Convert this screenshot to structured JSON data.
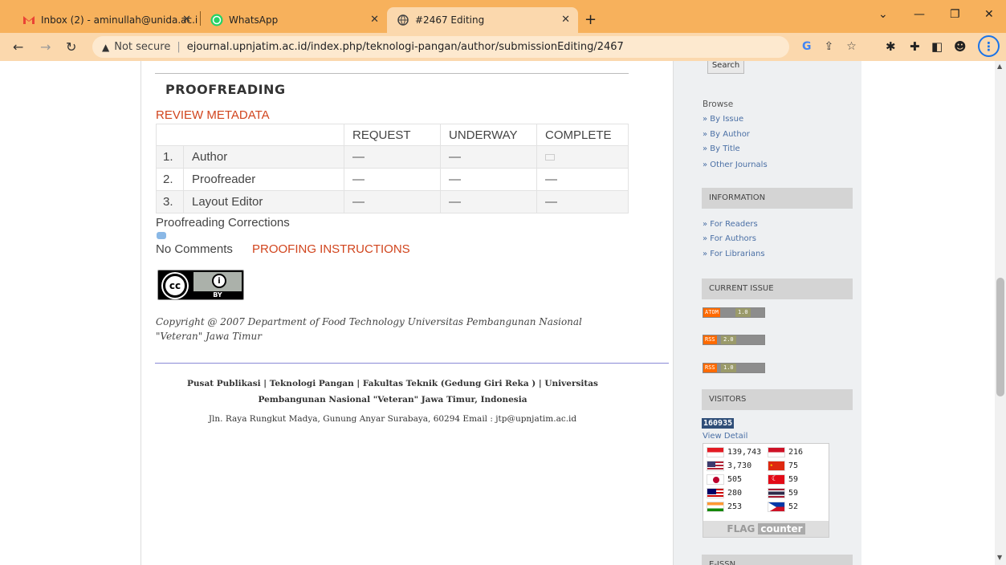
{
  "tabs": [
    {
      "label": "Inbox (2) - aminullah@unida.ac.i",
      "icon": "gmail-icon"
    },
    {
      "label": "WhatsApp",
      "icon": "whatsapp-icon"
    },
    {
      "label": "#2467 Editing",
      "icon": "globe-icon"
    }
  ],
  "address": {
    "not_secure": "Not secure",
    "url": "ejournal.upnjatim.ac.id/index.php/teknologi-pangan/author/submissionEditing/2467"
  },
  "colors": {
    "chrome": "#f7b15c",
    "accent_link": "#d1451e",
    "sidebar_link": "#4a6fa5"
  },
  "main": {
    "section_title": "PROOFREADING",
    "review_metadata": "REVIEW METADATA",
    "table": {
      "headers": [
        "REQUEST",
        "UNDERWAY",
        "COMPLETE"
      ],
      "rows": [
        {
          "num": "1.",
          "role": "Author",
          "request": "—",
          "underway": "—",
          "complete": ""
        },
        {
          "num": "2.",
          "role": "Proofreader",
          "request": "—",
          "underway": "—",
          "complete": "—"
        },
        {
          "num": "3.",
          "role": "Layout Editor",
          "request": "—",
          "underway": "—",
          "complete": "—"
        }
      ]
    },
    "proofreading_corrections": "Proofreading Corrections",
    "no_comments": "No Comments",
    "proofing_instructions": "PROOFING INSTRUCTIONS",
    "cc": {
      "cc": "cc",
      "by_icon": "i",
      "by": "BY"
    },
    "copyright": "Copyright @ 2007 Department of Food Technology Universitas Pembangunan Nasional \"Veteran\" Jawa Timur",
    "footer_line1": "Pusat Publikasi | Teknologi Pangan | Fakultas Teknik (Gedung Giri Reka ) | Universitas Pembangunan Nasional \"Veteran\" Jawa Timur, Indonesia",
    "footer_line2": "Jln. Raya Rungkut Madya, Gunung Anyar Surabaya, 60294 Email : jtp@upnjatim.ac.id"
  },
  "sidebar": {
    "search_button": "Search",
    "browse_title": "Browse",
    "browse_links": [
      "» By Issue",
      "» By Author",
      "» By Title",
      "» Other Journals"
    ],
    "information_title": "INFORMATION",
    "information_links": [
      "» For Readers",
      "» For Authors",
      "» For Librarians"
    ],
    "current_issue_title": "CURRENT ISSUE",
    "feeds": [
      {
        "left": "ATOM",
        "right": "1.0"
      },
      {
        "left": "RSS",
        "right": "2.0"
      },
      {
        "left": "RSS",
        "right": "1.0"
      }
    ],
    "visitors_title": "VISITORS",
    "visitor_count": "160935",
    "view_detail": "View Detail",
    "flag_counts_left": [
      "139,743",
      "3,730",
      "505",
      "280",
      "253"
    ],
    "flag_counts_right": [
      "216",
      "75",
      "59",
      "59",
      "52"
    ],
    "flag_counter_brand": "FLAG",
    "flag_counter_word": "counter",
    "eissn_title": "E-ISSN"
  }
}
